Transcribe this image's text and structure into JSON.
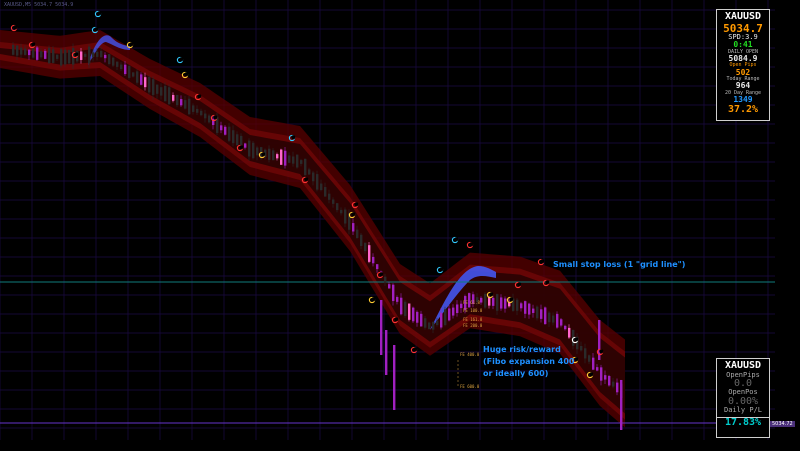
{
  "chart": {
    "symbol_title": "XAUUSD,M5  5034.7 5034.9",
    "colors": {
      "background": "#000000",
      "grid": "#1b0a45",
      "axis_text": "#5a5a8a",
      "band_outer": "#5a0000",
      "band_inner": "#7a0808",
      "candle_main": "#2a2a2a",
      "candle_bear_accent": "#a020c0",
      "candle_bull_accent": "#ff66cc",
      "fast_band": "#4455ee",
      "horizontal_line": "#0f7d7d",
      "bottom_line": "#6633cc"
    }
  },
  "info_panel": {
    "symbol": "XAUUSD",
    "bid": "5034.7",
    "spread": "SPD:3.9",
    "time_left": "0:41",
    "daily_open_label": "DAILY OPEN",
    "daily_open": "5084.9",
    "open_pips_label": "Open Pips",
    "open_pips": "502",
    "today_range_label": "Today Range",
    "today_range": "964",
    "range_20_label": "20 Day Range",
    "range_20": "1349",
    "percent": "37.2%"
  },
  "pl_panel": {
    "symbol": "XAUUSD",
    "open_pips_label": "OpenPips",
    "open_pips": "0.0",
    "open_pos_label": "OpenPos",
    "open_pos": "0.00%",
    "daily_pl_label": "Daily P/L",
    "daily_pl": "17.83%"
  },
  "annotations": {
    "stop_loss": "Small stop loss (1 \"grid line\")",
    "rr_1": "Huge risk/reward",
    "rr_2": "(Fibo expansion 400",
    "rr_3": "or ideally 600)"
  },
  "fibo_labels": [
    "FE 61.8",
    "FE 100.0",
    "FE 161.8",
    "FE 200.0",
    "FE 400.0",
    "FE 600.0"
  ],
  "price_tag": "5034.72"
}
